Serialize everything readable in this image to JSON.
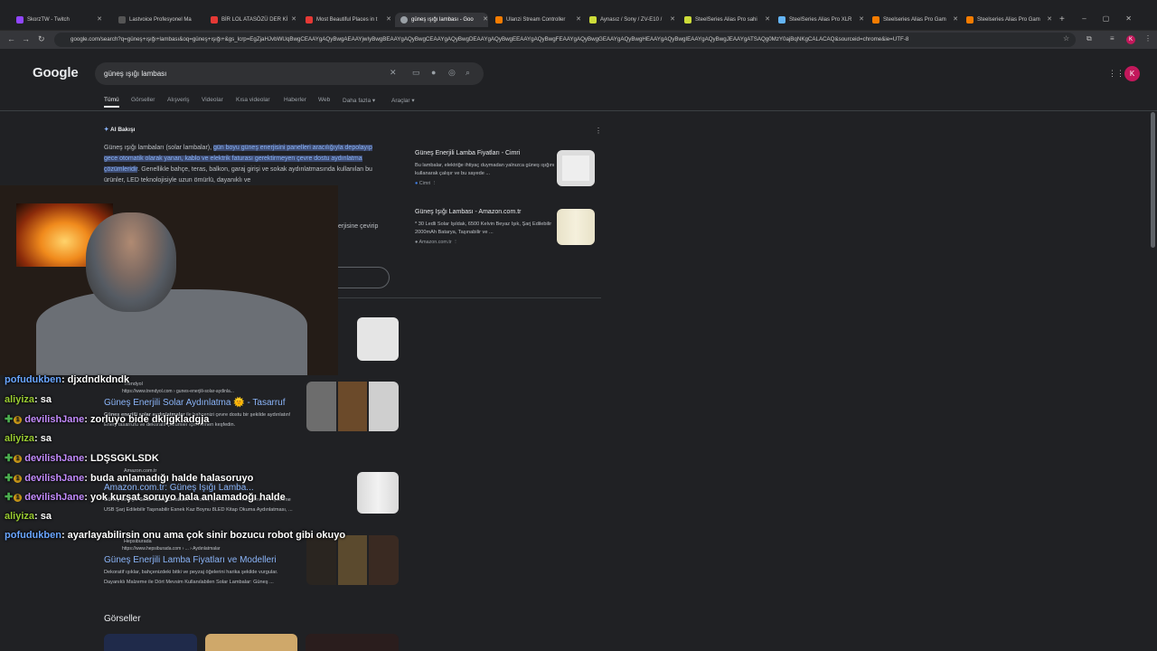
{
  "browser": {
    "tabs": [
      {
        "label": "SkorzTW - Twitch",
        "color": "#9146ff"
      },
      {
        "label": "Lastvoice Profesyonel Ma",
        "color": "#555"
      },
      {
        "label": "BİR LOL ATASÖZÜ DER Kİ",
        "color": "#e53935"
      },
      {
        "label": "Most Beautiful Places in t",
        "color": "#e53935"
      },
      {
        "label": "güneş ışığı lambası - Goo",
        "color": "#9aa0a6"
      },
      {
        "label": "Ulanzi Stream Controller",
        "color": "#f57c00"
      },
      {
        "label": "Aynasız / Sony / ZV-E10 /",
        "color": "#cddc39"
      },
      {
        "label": "SteelSeries Alias Pro sahi",
        "color": "#cddc39"
      },
      {
        "label": "SteelSeries Alias Pro XLR",
        "color": "#64b5f6"
      },
      {
        "label": "Steelseries Alias Pro Gam",
        "color": "#f57c00"
      },
      {
        "label": "Steelseries Alias Pro Gam",
        "color": "#f57c00"
      }
    ],
    "url": "google.com/search?q=güneş+ışığı+lambası&oq=güneş+ışığı+&gs_lcrp=EgZjaHJvbWUqBwgCEAAYgAQyBwgAEAAYjwIyBwgBEAAYgAQyBwgCEAAYgAQyBwgDEAAYgAQyBwgEEAAYgAQyBwgFEAAYgAQyBwgGEAAYgAQyBwgHEAAYgAQyBwgIEAAYgAQyBwgJEAAYgATSAQg0MzY0ajBqNKgCALACAQ&sourceid=chrome&ie=UTF-8",
    "account_initial": "K"
  },
  "google": {
    "logo": "Google",
    "query": "güneş ışığı lambası",
    "search_tabs": [
      "Tümü",
      "Görseller",
      "Alışveriş",
      "Videolar",
      "Kısa videolar",
      "Haberler",
      "Web",
      "Daha fazla ▾",
      "Araçlar ▾"
    ],
    "ai_overview": {
      "heading": "AI Bakışı",
      "text_plain": "Güneş ışığı lambaları (solar lambalar), ",
      "text_highlight": "gün boyu güneş enerjisini panelleri aracılığıyla depolayıp gece otomatik olarak yanan, kablo ve elektrik faturası gerektirmeyen çevre dostu aydınlatma çözümleridir",
      "text_rest": ". Genellikle bahçe, teras, balkon, garaj girişi ve sokak aydınlatmasında kullanılan bu ürünler, LED teknolojisiyle uzun ömürlü, dayanıklı ve",
      "fragment": "erjisine çevirip"
    },
    "source_cards": [
      {
        "title": "Güneş Enerjili Lamba Fiyatları - Cimri",
        "desc": "Bu lambalar, elektriğe ihtiyaç duymadan yalnızca güneş ışığını kullanarak çalışır ve bu sayede ...",
        "source": "Cimri"
      },
      {
        "title": "Güneş Işığı Lambası - Amazon.com.tr",
        "desc": "* 30 Ledli Solar Işıldak, 6500 Kelvin Beyaz Işık, Şarj Edilebilir 2000mAh Batarya, Taşınabilir ve ...",
        "source": "Amazon.com.tr"
      }
    ],
    "results": [
      {
        "site": "Trendyol",
        "url": "https://www.trendyol.com › gunes-enerjili-solar-aydinla...",
        "title": "Güneş Enerjili Solar Aydınlatma 🌞 - Tasarruf",
        "desc_bold": "Güneş enerjili solar aydınlatmalar",
        "desc": " ile bahçenizi çevre dostu bir şekilde aydınlatın! Enerji tasarrufu ve dekoratif çözümler için hemen keşfedin."
      },
      {
        "site": "Amazon.com.tr",
        "url": "",
        "title": "Amazon.com.tr: Güneş Işığı Lamba...",
        "desc_bold": "Güneş Enerjili Solar Masa Lambası",
        "desc": ", 3 Modlu, Işık Gücünü Kısabilme ve Açabilme USB Şarj Edilebilir Taşınabilir Esnek Kaz Boynu 8LED Kitap Okuma Aydınlatması, ..."
      },
      {
        "site": "Hepsiburada",
        "url": "https://www.hepsiburada.com › ... › Aydınlatmalar",
        "title": "Güneş Enerjili Lamba Fiyatları ve Modelleri",
        "desc_bold": "",
        "desc": "Dekoratif ışıklar, bahçenizdeki bitki ve peyzaj öğelerini harika şekilde vurgular. Dayanıklı Malzeme ile Dört Mevsim Kullanılabilen Solar Lambalar: Güneş ..."
      }
    ],
    "images_heading": "Görseller"
  },
  "chat": [
    {
      "user": "pofudukben",
      "color": "#6aa6ff",
      "badges": false,
      "text": ": djxdndkdndk"
    },
    {
      "user": "aliyiza",
      "color": "#9acd32",
      "badges": false,
      "text": ": sa"
    },
    {
      "user": "devilishJane",
      "color": "#c48cff",
      "badges": true,
      "text": ": zorluyo bide dkljgkladgja"
    },
    {
      "user": "aliyiza",
      "color": "#9acd32",
      "badges": false,
      "text": ": sa"
    },
    {
      "user": "devilishJane",
      "color": "#c48cff",
      "badges": true,
      "text": ": LDŞSGKLSDK"
    },
    {
      "user": "devilishJane",
      "color": "#c48cff",
      "badges": true,
      "text": ": buda anlamadığı halde halasoruyo"
    },
    {
      "user": "devilishJane",
      "color": "#c48cff",
      "badges": true,
      "text": ": yok kurşat soruyo hala anlamadoğı halde"
    },
    {
      "user": "aliyiza",
      "color": "#9acd32",
      "badges": false,
      "text": ": sa"
    },
    {
      "user": "pofudukben",
      "color": "#6aa6ff",
      "badges": false,
      "text": ": ayarlayabilirsin onu ama çok sinir bozucu robot gibi okuyo"
    }
  ],
  "chat_badge_label": "1"
}
